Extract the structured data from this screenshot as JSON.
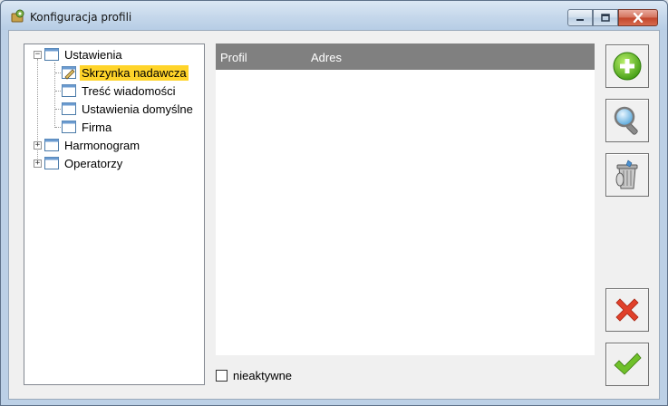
{
  "window": {
    "title": "Konfiguracja profili"
  },
  "tree": {
    "items": [
      {
        "label": "Ustawienia",
        "expander": "−"
      },
      {
        "label": "Skrzynka nadawcza"
      },
      {
        "label": "Treść wiadomości"
      },
      {
        "label": "Ustawienia domyślne"
      },
      {
        "label": "Firma"
      },
      {
        "label": "Harmonogram",
        "expander": "+"
      },
      {
        "label": "Operatorzy",
        "expander": "+"
      }
    ]
  },
  "list": {
    "columns": [
      "Profil",
      "Adres"
    ]
  },
  "inactive_checkbox": {
    "label": "nieaktywne"
  },
  "toolbar": {
    "icons": [
      "add-icon",
      "search-icon",
      "trash-icon",
      "close-icon",
      "checkmark-icon"
    ]
  },
  "colors": {
    "selection": "#ffd42a",
    "list_header": "#808080",
    "add": "#5fbf1f",
    "cancel": "#e0402a",
    "confirm": "#6fc02a"
  }
}
